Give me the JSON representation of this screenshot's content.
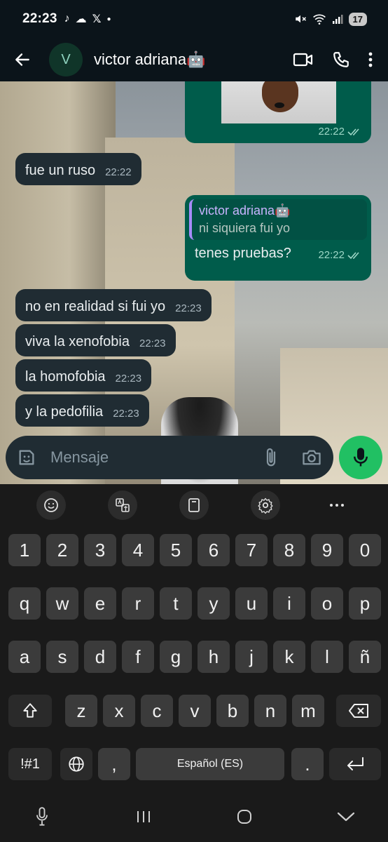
{
  "status_bar": {
    "time": "22:23",
    "battery_level": "17"
  },
  "header": {
    "avatar_initial": "V",
    "contact_name": "victor adriana🤖"
  },
  "messages": [
    {
      "direction": "out",
      "type": "image",
      "time": "22:22",
      "status": "read"
    },
    {
      "direction": "in",
      "text": "fue un ruso",
      "time": "22:22"
    },
    {
      "direction": "out",
      "reply_to_name": "victor adriana🤖",
      "reply_to_text": "ni siquiera fui yo",
      "text": "tenes pruebas?",
      "time": "22:22",
      "status": "read"
    },
    {
      "direction": "in",
      "text": "no en realidad si fui yo",
      "time": "22:23"
    },
    {
      "direction": "in",
      "text": "viva la xenofobia",
      "time": "22:23"
    },
    {
      "direction": "in",
      "text": "la homofobia",
      "time": "22:23"
    },
    {
      "direction": "in",
      "text": "y la pedofilia",
      "time": "22:23"
    }
  ],
  "composer": {
    "placeholder": "Mensaje"
  },
  "keyboard": {
    "row_numbers": [
      "1",
      "2",
      "3",
      "4",
      "5",
      "6",
      "7",
      "8",
      "9",
      "0"
    ],
    "row_1": [
      "q",
      "w",
      "e",
      "r",
      "t",
      "y",
      "u",
      "i",
      "o",
      "p"
    ],
    "row_2": [
      "a",
      "s",
      "d",
      "f",
      "g",
      "h",
      "j",
      "k",
      "l",
      "ñ"
    ],
    "row_3": [
      "z",
      "x",
      "c",
      "v",
      "b",
      "n",
      "m"
    ],
    "symbols_key": "!#1",
    "comma_key": ",",
    "space_label": "Español (ES)",
    "period_key": "."
  },
  "colors": {
    "header_bg": "#0b141a",
    "incoming_bubble": "#202c33",
    "outgoing_bubble": "#005c4b",
    "mic_button": "#21c063",
    "keyboard_bg": "#1a1a1a"
  }
}
